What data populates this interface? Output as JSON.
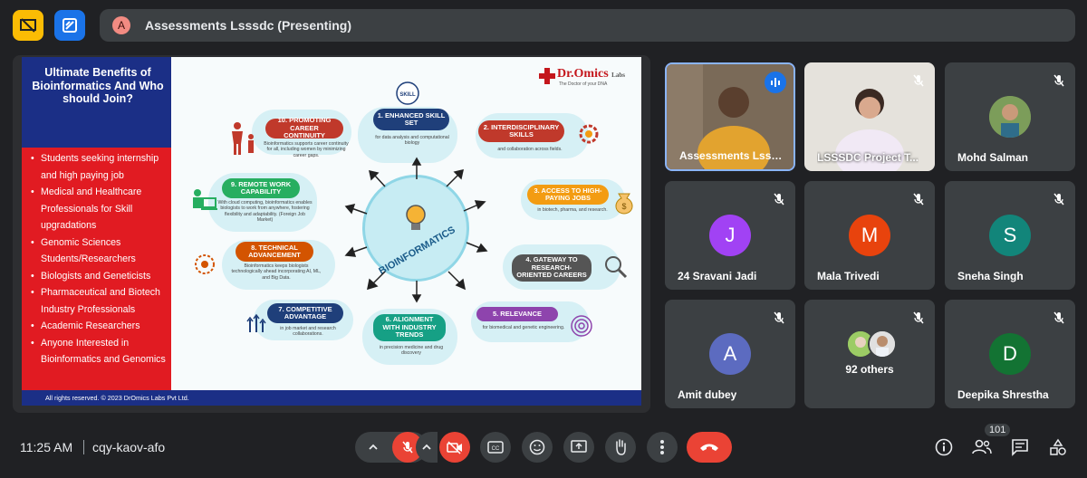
{
  "meeting": {
    "title": "Assessments Lsssdc (Presenting)",
    "presenter_avatar_letter": "A",
    "time": "11:25 AM",
    "code": "cqy-kaov-afo",
    "participant_count": "101"
  },
  "slide": {
    "heading": "Ultimate Benefits of Bioinformatics And Who should Join?",
    "audience": [
      "Students seeking internship and high paying job",
      "Medical and Healthcare Professionals for Skill upgradations",
      "Genomic Sciences Students/Researchers",
      "Biologists and Geneticists",
      "Pharmaceutical and Biotech Industry Professionals",
      "Academic Researchers",
      "Anyone Interested in Bioinformatics and Genomics"
    ],
    "footer": "All rights reserved. © 2023 DrOmics Labs Pvt Ltd.",
    "logo_name": "Dr.Omics",
    "logo_suffix": "Labs",
    "logo_tagline": "The Doctor of your DNA",
    "center_label": "BIOINFORMATICS",
    "skill_badge": "SKILL",
    "benefits": [
      {
        "title": "1. ENHANCED SKILL SET",
        "desc": "for data analysis and computational biology",
        "color": "#1f3f7a"
      },
      {
        "title": "2. INTERDISCIPLINARY SKILLS",
        "desc": "and collaboration across fields.",
        "color": "#c0392b"
      },
      {
        "title": "3. ACCESS TO HIGH-PAYING JOBS",
        "desc": "in biotech, pharma, and research.",
        "color": "#f39c12"
      },
      {
        "title": "4. GATEWAY TO RESEARCH-ORIENTED CAREERS",
        "desc": "",
        "color": "#555555"
      },
      {
        "title": "5. RELEVANCE",
        "desc": "for biomedical and genetic engineering.",
        "color": "#8e44ad"
      },
      {
        "title": "6. ALIGNMENT WITH INDUSTRY TRENDS",
        "desc": "in precision medicine and drug discovery",
        "color": "#16a085"
      },
      {
        "title": "7. COMPETITIVE ADVANTAGE",
        "desc": "in job market and research collaborations.",
        "color": "#1f3f7a"
      },
      {
        "title": "8. TECHNICAL ADVANCEMENT",
        "desc": "Bioinformatics keeps biologists technologically ahead incorporating AI, ML, and Big Data.",
        "color": "#d35400"
      },
      {
        "title": "9. REMOTE WORK CAPABILITY",
        "desc": "With cloud computing, bioinformatics enables biologists to work from anywhere, fostering flexibility and adaptability. (Foreign Job Market)",
        "color": "#27ae60"
      },
      {
        "title": "10. PROMOTING CAREER CONTINUITY",
        "desc": "Bioinformatics supports career continuity for all, including women by minimizing career gaps.",
        "color": "#c0392b"
      }
    ]
  },
  "participants": [
    {
      "name": "Assessments Lsss...",
      "type": "video",
      "speaking": true
    },
    {
      "name": "LSSSDC Project T...",
      "type": "video",
      "muted": true
    },
    {
      "name": "Mohd Salman",
      "type": "photo",
      "muted": true
    },
    {
      "name": "24 Sravani Jadi",
      "letter": "J",
      "color": "#a142f4",
      "muted": true
    },
    {
      "name": "Mala Trivedi",
      "letter": "M",
      "color": "#e8430d",
      "muted": true
    },
    {
      "name": "Sneha Singh",
      "letter": "S",
      "color": "#12857a",
      "muted": true
    },
    {
      "name": "Amit dubey",
      "letter": "A",
      "color": "#5c6bc0",
      "muted": true
    },
    {
      "name": "92 others",
      "type": "others",
      "muted": true
    },
    {
      "name": "Deepika Shrestha",
      "letter": "D",
      "color": "#137333",
      "muted": true
    }
  ]
}
